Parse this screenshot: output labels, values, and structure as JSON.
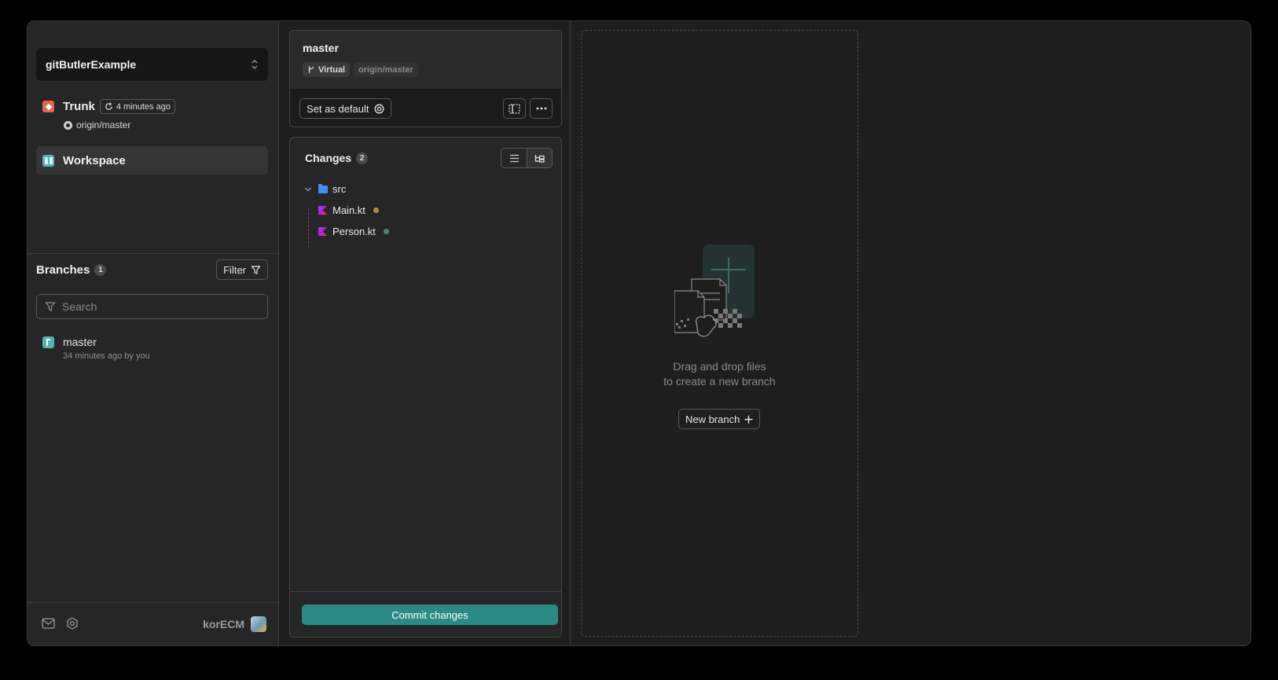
{
  "sidebar": {
    "project_name": "gitButlerExample",
    "trunk": {
      "label": "Trunk",
      "updated": "4 minutes ago",
      "remote": "origin/master"
    },
    "workspace_label": "Workspace",
    "branches": {
      "title": "Branches",
      "count": "1",
      "filter_label": "Filter",
      "search_placeholder": "Search",
      "items": [
        {
          "name": "master",
          "meta": "34 minutes ago by you"
        }
      ]
    },
    "footer": {
      "username": "korECM"
    }
  },
  "branch_card": {
    "title": "master",
    "tag_virtual": "Virtual",
    "tag_remote": "origin/master",
    "set_default_label": "Set as default"
  },
  "changes": {
    "title": "Changes",
    "count": "2",
    "folder": "src",
    "files": [
      {
        "name": "Main.kt",
        "status_color": "#b8883a"
      },
      {
        "name": "Person.kt",
        "status_color": "#3f8a6c"
      }
    ],
    "commit_label": "Commit changes"
  },
  "dropzone": {
    "line1": "Drag and drop files",
    "line2": "to create a new branch",
    "new_branch_label": "New branch"
  },
  "colors": {
    "accent": "#2b8a84",
    "trunk": "#e8654a",
    "workspace": "#4fb7ac"
  }
}
